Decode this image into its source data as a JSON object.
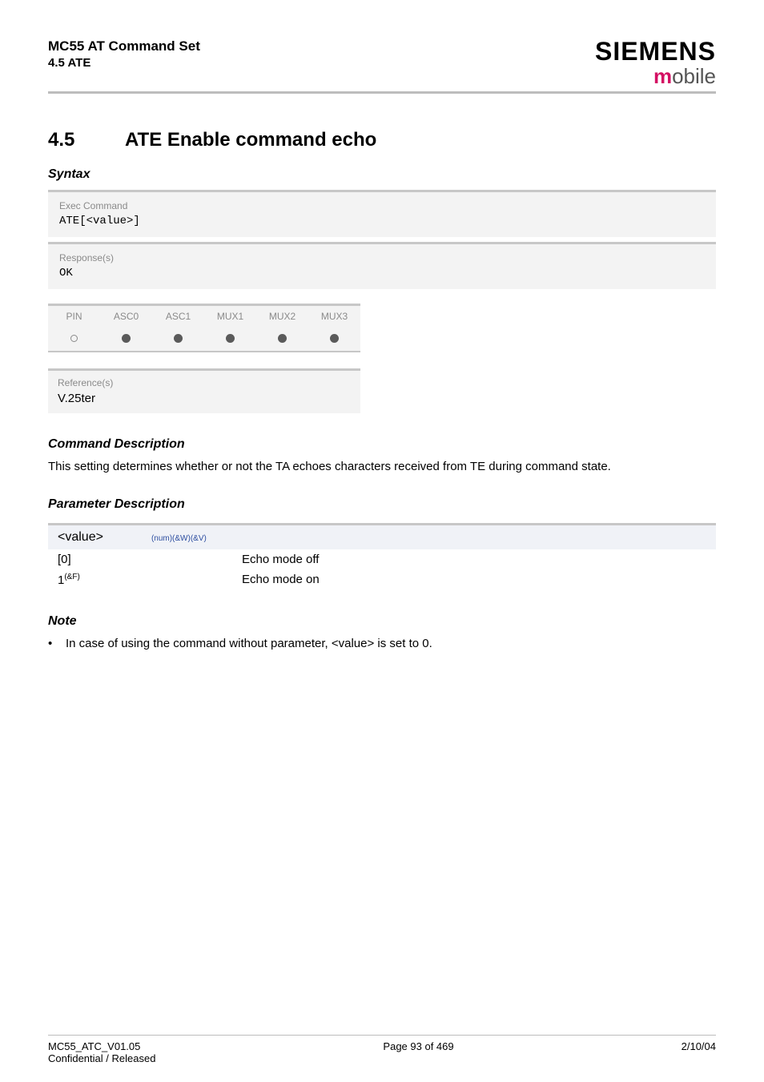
{
  "header": {
    "title": "MC55 AT Command Set",
    "subtitle": "4.5 ATE",
    "logo_brand": "SIEMENS",
    "logo_sub_m": "m",
    "logo_sub_rest": "obile"
  },
  "section": {
    "num": "4.5",
    "title": "ATE   Enable command echo"
  },
  "syntax_h": "Syntax",
  "exec": {
    "label": "Exec Command",
    "cmd_prefix": "ATE[",
    "cmd_param": "<value>",
    "cmd_suffix": "]"
  },
  "response": {
    "label": "Response(s)",
    "text": "OK"
  },
  "pin": {
    "cols": [
      "PIN",
      "ASC0",
      "ASC1",
      "MUX1",
      "MUX2",
      "MUX3"
    ],
    "dots": [
      "open",
      "filled",
      "filled",
      "filled",
      "filled",
      "filled"
    ]
  },
  "ref": {
    "label": "Reference(s)",
    "value": "V.25ter"
  },
  "cmd_desc_h": "Command Description",
  "cmd_desc": "This setting determines whether or not the TA echoes characters received from TE during command state.",
  "param_desc_h": "Parameter Description",
  "param": {
    "name": "<value>",
    "tag": "(num)(&W)(&V)",
    "rows": [
      {
        "v": "[0]",
        "d": "Echo mode off"
      },
      {
        "v_base": "1",
        "v_sup": "(&F)",
        "d": "Echo mode on"
      }
    ]
  },
  "note_h": "Note",
  "note_text_a": "In case of using the command without parameter, ",
  "note_text_param": "<value>",
  "note_text_b": " is set to 0.",
  "footer": {
    "l1": "MC55_ATC_V01.05",
    "l2": "Confidential / Released",
    "center": "Page 93 of 469",
    "right": "2/10/04"
  }
}
